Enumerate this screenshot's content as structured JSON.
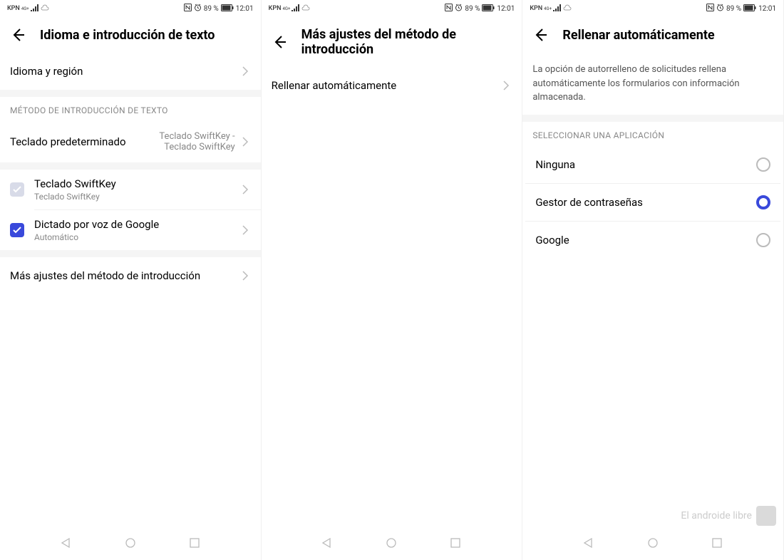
{
  "status": {
    "carrier": "KPN",
    "network": "4G+",
    "battery_text": "89 %",
    "time": "12:01"
  },
  "screen1": {
    "title": "Idioma e introducción de texto",
    "item_language": "Idioma y región",
    "section_input": "MÉTODO DE INTRODUCCIÓN DE TEXTO",
    "default_keyboard_label": "Teclado predeterminado",
    "default_keyboard_value": "Teclado SwiftKey - Teclado SwiftKey",
    "swiftkey_title": "Teclado SwiftKey",
    "swiftkey_sub": "Teclado SwiftKey",
    "google_voice_title": "Dictado por voz de Google",
    "google_voice_sub": "Automático",
    "more_settings": "Más ajustes del método de introducción"
  },
  "screen2": {
    "title": "Más ajustes del método de introducción",
    "autofill": "Rellenar automáticamente"
  },
  "screen3": {
    "title": "Rellenar automáticamente",
    "description": "La opción de autorrelleno de solicitudes rellena automáticamente los formularios con información almacenada.",
    "section_select": "SELECCIONAR UNA APLICACIÓN",
    "opt_none": "Ninguna",
    "opt_password": "Gestor de contraseñas",
    "opt_google": "Google"
  },
  "watermark": "El androide libre"
}
